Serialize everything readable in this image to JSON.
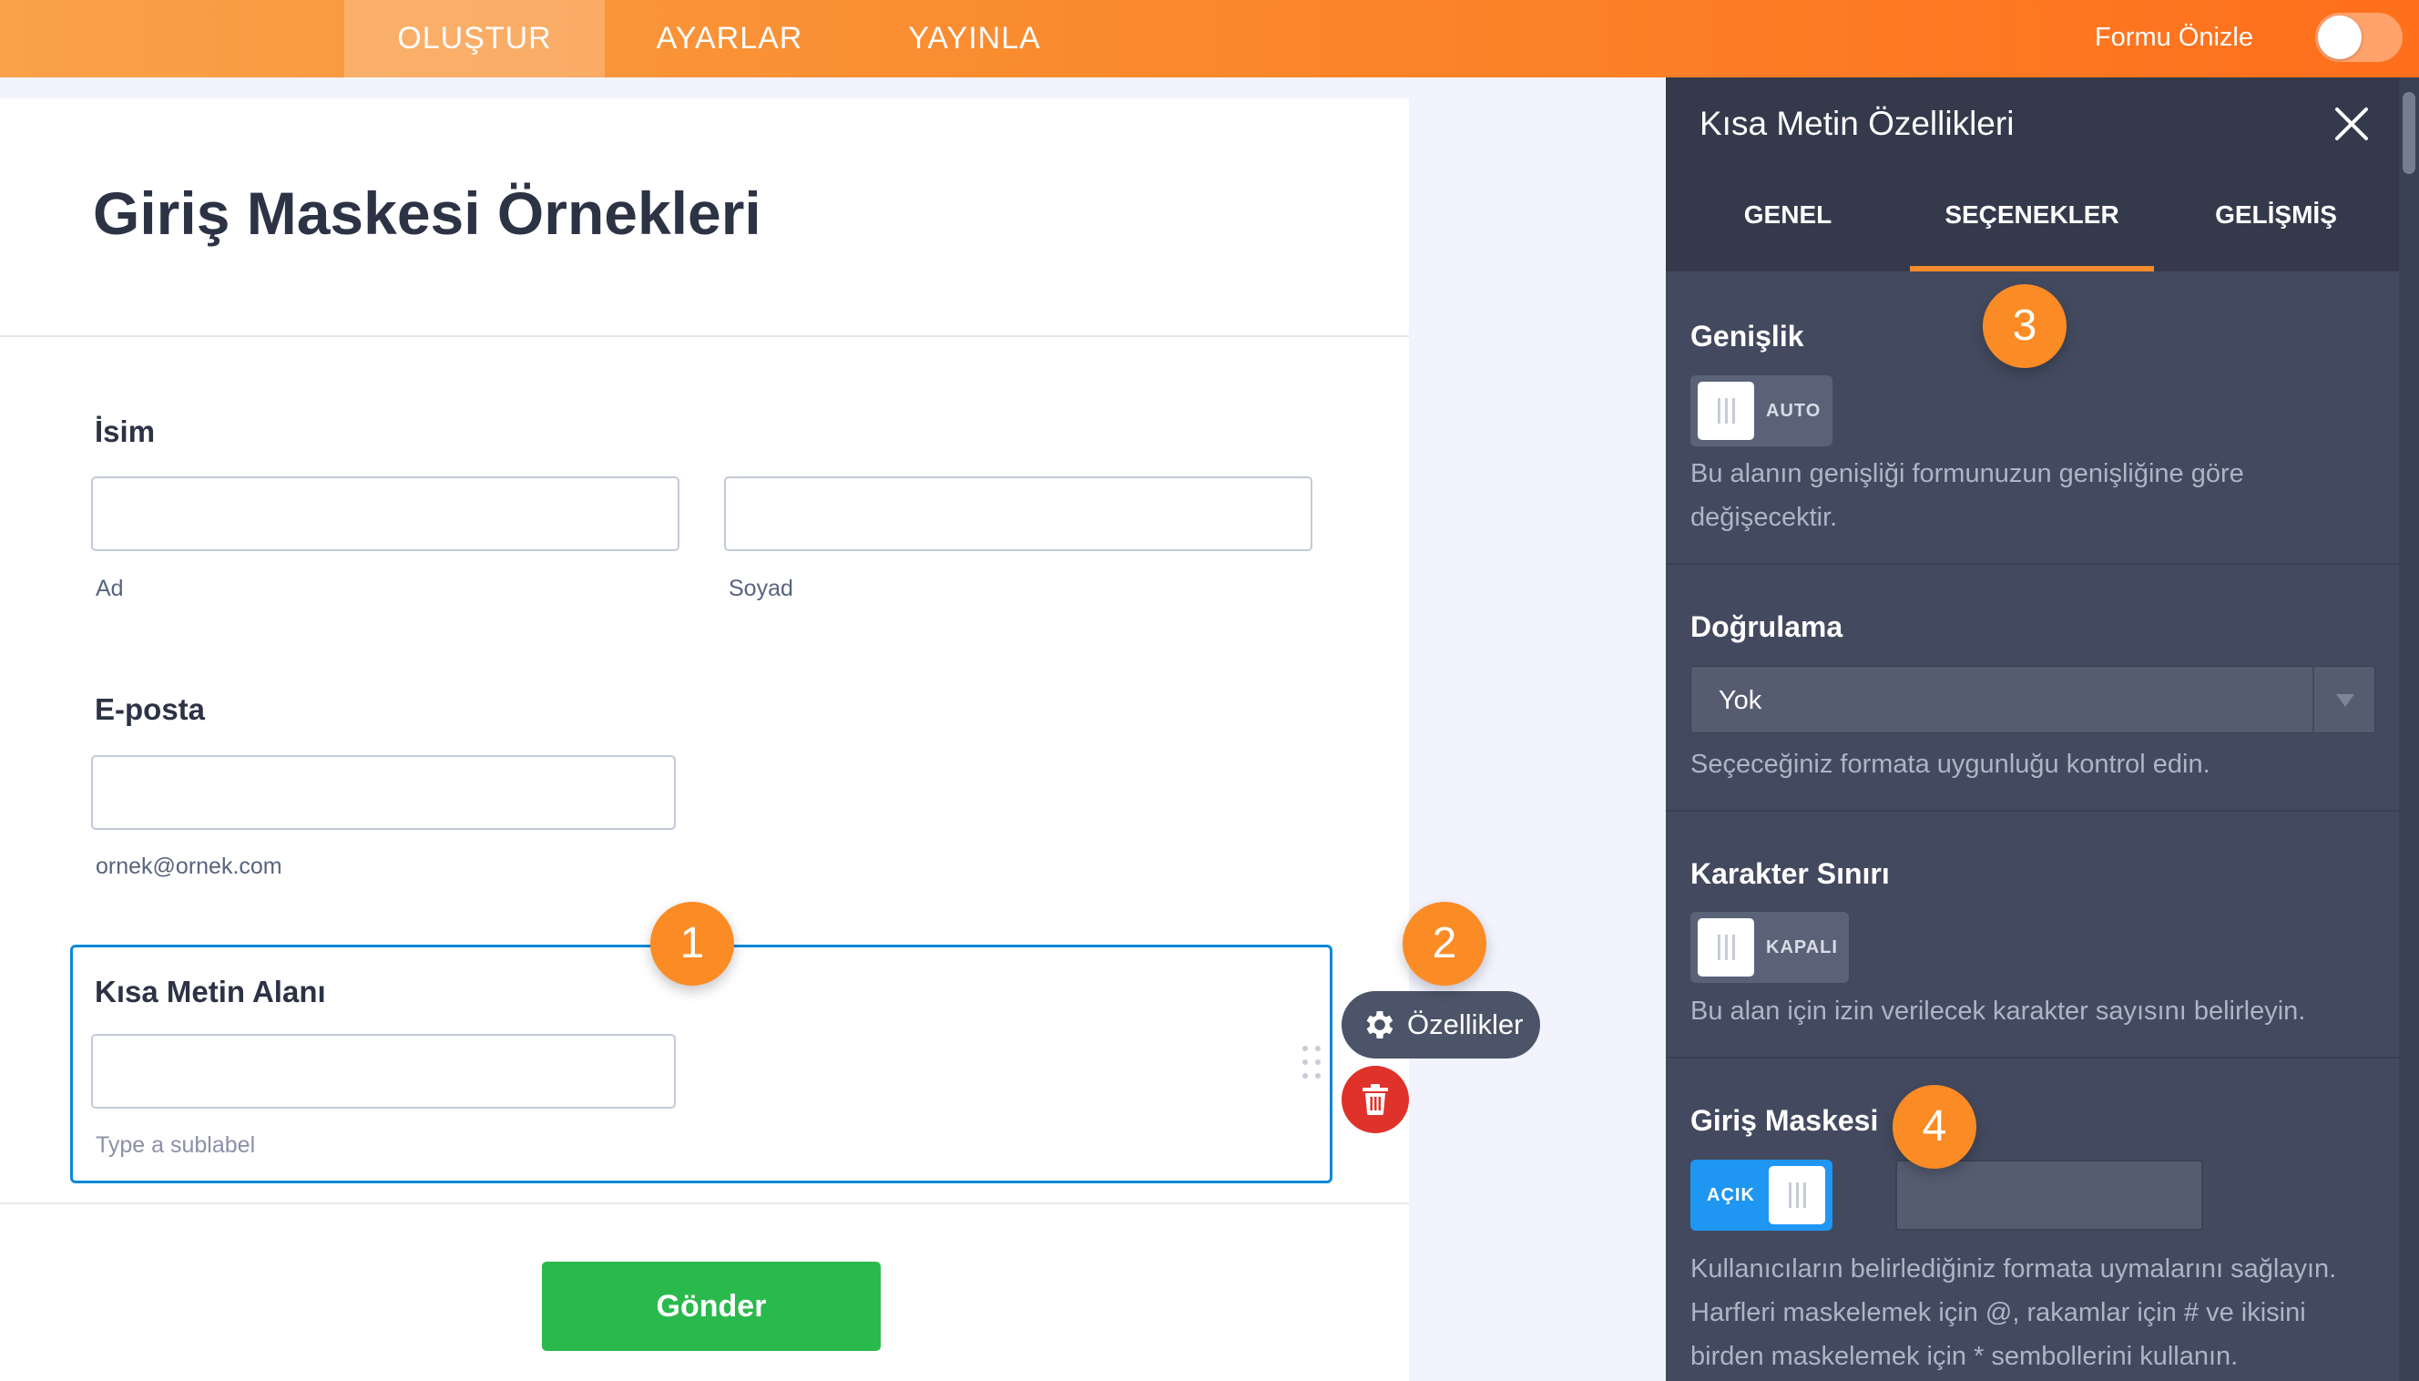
{
  "topbar": {
    "tabs": [
      {
        "label": "OLUŞTUR",
        "active": true
      },
      {
        "label": "AYARLAR",
        "active": false
      },
      {
        "label": "YAYINLA",
        "active": false
      }
    ],
    "preview_label": "Formu Önizle",
    "preview_toggle_on": false
  },
  "form": {
    "title": "Giriş Maskesi Örnekleri",
    "name_field": {
      "label": "İsim",
      "first_sublabel": "Ad",
      "last_sublabel": "Soyad"
    },
    "email_field": {
      "label": "E-posta",
      "sublabel": "ornek@ornek.com"
    },
    "short_text_field": {
      "label": "Kısa Metin Alanı",
      "sublabel_placeholder": "Type a sublabel"
    },
    "submit_label": "Gönder"
  },
  "field_actions": {
    "properties_label": "Özellikler"
  },
  "markers": [
    "1",
    "2",
    "3",
    "4"
  ],
  "panel": {
    "title": "Kısa Metin Özellikleri",
    "tabs": [
      {
        "label": "GENEL",
        "active": false
      },
      {
        "label": "SEÇENEKLER",
        "active": true
      },
      {
        "label": "GELİŞMİŞ",
        "active": false
      }
    ],
    "width": {
      "title": "Genişlik",
      "switch_text": "AUTO",
      "description": "Bu alanın genişliği formunuzun genişliğine göre değişecektir."
    },
    "validation": {
      "title": "Doğrulama",
      "selected": "Yok",
      "description": "Seçeceğiniz formata uygunluğu kontrol edin."
    },
    "char_limit": {
      "title": "Karakter Sınırı",
      "switch_text": "KAPALI",
      "description": "Bu alan için izin verilecek karakter sayısını belirleyin."
    },
    "input_mask": {
      "title": "Giriş Maskesi",
      "switch_text": "AÇIK",
      "mask_value": "",
      "description": "Kullanıcıların belirlediğiniz formata uymalarını sağlayın. Harfleri maskelemek için @, rakamlar için # ve ikisini birden maskelemek için * sembollerini kullanın."
    }
  },
  "colors": {
    "topbar_orange": "#fa8a2e",
    "panel_bg": "#434a5f",
    "submit_green": "#2ab94d",
    "select_blue": "#0a88d8",
    "delete_red": "#de322b",
    "switch_on_blue": "#1f96f2"
  }
}
